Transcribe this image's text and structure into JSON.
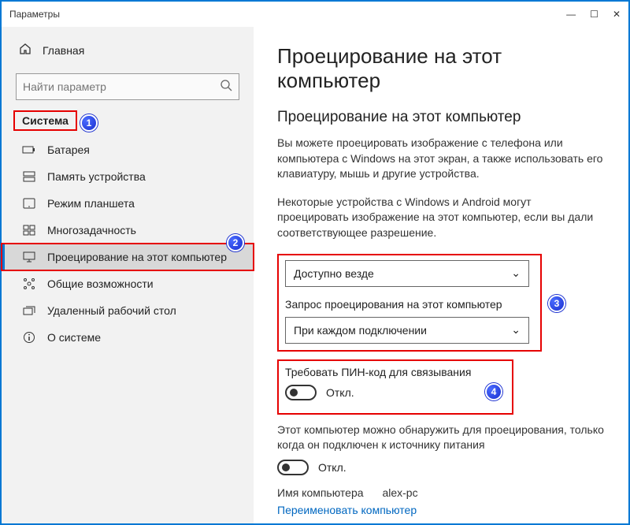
{
  "window": {
    "title": "Параметры"
  },
  "sidebar": {
    "home": "Главная",
    "search_placeholder": "Найти параметр",
    "category": "Система",
    "items": [
      {
        "icon": "battery",
        "label": "Батарея"
      },
      {
        "icon": "storage",
        "label": "Память устройства"
      },
      {
        "icon": "tablet",
        "label": "Режим планшета"
      },
      {
        "icon": "multitask",
        "label": "Многозадачность"
      },
      {
        "icon": "project",
        "label": "Проецирование на этот компьютер",
        "selected": true
      },
      {
        "icon": "shared",
        "label": "Общие возможности"
      },
      {
        "icon": "remote",
        "label": "Удаленный рабочий стол"
      },
      {
        "icon": "about",
        "label": "О системе"
      }
    ]
  },
  "main": {
    "page_title": "Проецирование на этот компьютер",
    "section_title": "Проецирование на этот компьютер",
    "desc1": "Вы можете проецировать изображение с телефона или компьютера с Windows на этот экран, а также использовать его клавиатуру, мышь и другие устройства.",
    "desc2": "Некоторые устройства с Windows и Android могут проецировать изображение на этот компьютер, если вы дали соответствующее разрешение.",
    "dropdown1_value": "Доступно везде",
    "sub_label1": "Запрос проецирования на этот компьютер",
    "dropdown2_value": "При каждом подключении",
    "pin_label": "Требовать ПИН-код для связывания",
    "toggle_off": "Откл.",
    "power_text": "Этот компьютер можно обнаружить для проецирования, только когда он подключен к источнику питания",
    "pcname_label": "Имя компьютера",
    "pcname_value": "alex-pc",
    "rename_link": "Переименовать компьютер"
  },
  "badges": {
    "b1": "1",
    "b2": "2",
    "b3": "3",
    "b4": "4"
  }
}
